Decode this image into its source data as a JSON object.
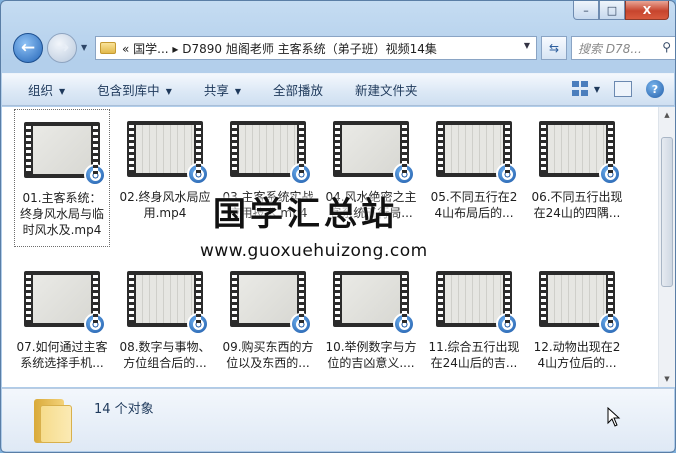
{
  "window": {
    "minimize_glyph": "–",
    "maximize_glyph": "□",
    "close_glyph": "X"
  },
  "address": {
    "path": "« 国学... ▸ D7890 旭阁老师 主客系统（弟子班）视频14集",
    "dropdown_glyph": "▼"
  },
  "search": {
    "placeholder": "搜索 D78...",
    "icon": "search-icon"
  },
  "toolbar": {
    "organize": "组织",
    "include_library": "包含到库中",
    "share": "共享",
    "play_all": "全部播放",
    "new_folder": "新建文件夹"
  },
  "files": [
    {
      "label": "01.主客系统：终身风水局与临时风水及.mp4"
    },
    {
      "label": "02.终身风水局应用.mp4"
    },
    {
      "label": "03.主客系统实战应用技术.mp4"
    },
    {
      "label": "04.风水绝密之主客系统五行局..."
    },
    {
      "label": "05.不同五行在24山布局后的..."
    },
    {
      "label": "06.不同五行出现在24山的四隅..."
    },
    {
      "label": "07.如何通过主客系统选择手机..."
    },
    {
      "label": "08.数字与事物、方位组合后的..."
    },
    {
      "label": "09.购买东西的方位以及东西的..."
    },
    {
      "label": "10.举例数字与方位的吉凶意义...."
    },
    {
      "label": "11.综合五行出现在24山后的吉..."
    },
    {
      "label": "12.动物出现在24山方位后的..."
    }
  ],
  "watermark": {
    "cn": "国学汇总站",
    "url": "www.guoxuehuizong.com"
  },
  "details": {
    "count": "14 个对象"
  },
  "colors": {
    "accent": "#1b57a6",
    "toolbar_text": "#1e395b"
  }
}
